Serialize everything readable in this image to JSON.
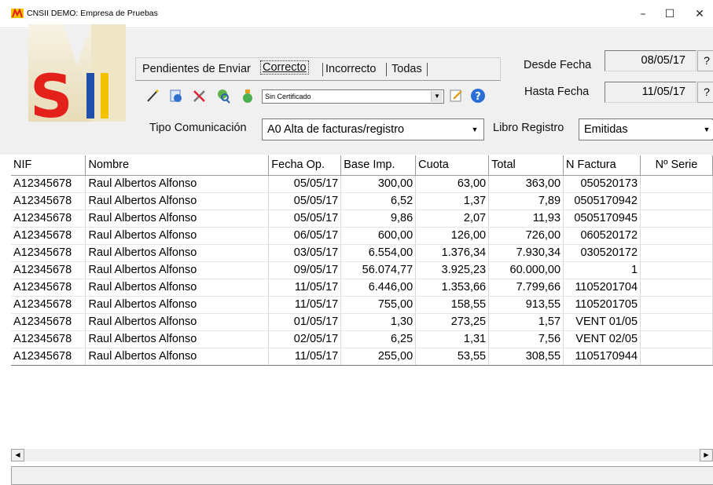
{
  "window": {
    "title": "CNSII DEMO: Empresa de Pruebas",
    "minimize": "–",
    "maximize": "☐",
    "close": "✕"
  },
  "header": {
    "logo_text": "SII",
    "tabs": [
      {
        "label": "Pendientes de Enviar",
        "active": false
      },
      {
        "label": "Correcto",
        "active": true
      },
      {
        "label": "Incorrecto",
        "active": false
      },
      {
        "label": "Todas",
        "active": false
      }
    ],
    "toolbar_icons": [
      "magic-wand-icon",
      "document-icon",
      "tools-icon",
      "search-globe-icon",
      "certificate-bag-icon"
    ],
    "certificate_select": "Sin Certificado",
    "after_select_icons": [
      "edit-icon",
      "help-icon"
    ],
    "desde_label": "Desde Fecha",
    "desde_value": "08/05/17",
    "hasta_label": "Hasta Fecha",
    "hasta_value": "11/05/17",
    "question": "?",
    "tipo_label": "Tipo Comunicación",
    "tipo_value": "A0 Alta de facturas/registro",
    "libro_label": "Libro Registro",
    "libro_value": "Emitidas"
  },
  "grid": {
    "columns": [
      "NIF",
      "Nombre",
      "Fecha Op.",
      "Base Imp.",
      "Cuota",
      "Total",
      "N Factura",
      "Nº Serie"
    ],
    "rows": [
      [
        "A12345678",
        "Raul Albertos Alfonso",
        "05/05/17",
        "300,00",
        "63,00",
        "363,00",
        "050520173",
        ""
      ],
      [
        "A12345678",
        "Raul Albertos Alfonso",
        "05/05/17",
        "6,52",
        "1,37",
        "7,89",
        "0505170942",
        ""
      ],
      [
        "A12345678",
        "Raul Albertos Alfonso",
        "05/05/17",
        "9,86",
        "2,07",
        "11,93",
        "0505170945",
        ""
      ],
      [
        "A12345678",
        "Raul Albertos Alfonso",
        "06/05/17",
        "600,00",
        "126,00",
        "726,00",
        "060520172",
        ""
      ],
      [
        "A12345678",
        "Raul Albertos Alfonso",
        "03/05/17",
        "6.554,00",
        "1.376,34",
        "7.930,34",
        "030520172",
        ""
      ],
      [
        "A12345678",
        "Raul Albertos Alfonso",
        "09/05/17",
        "56.074,77",
        "3.925,23",
        "60.000,00",
        "1",
        ""
      ],
      [
        "A12345678",
        "Raul Albertos Alfonso",
        "11/05/17",
        "6.446,00",
        "1.353,66",
        "7.799,66",
        "1105201704",
        ""
      ],
      [
        "A12345678",
        "Raul Albertos Alfonso",
        "11/05/17",
        "755,00",
        "158,55",
        "913,55",
        "1105201705",
        ""
      ],
      [
        "A12345678",
        "Raul Albertos Alfonso",
        "01/05/17",
        "1,30",
        "273,25",
        "1,57",
        "VENT 01/05",
        ""
      ],
      [
        "A12345678",
        "Raul Albertos Alfonso",
        "02/05/17",
        "6,25",
        "1,31",
        "7,56",
        "VENT 02/05",
        ""
      ],
      [
        "A12345678",
        "Raul Albertos Alfonso",
        "11/05/17",
        "255,00",
        "53,55",
        "308,55",
        "1105170944",
        ""
      ]
    ]
  },
  "scroll": {
    "left": "◀",
    "right": "▶"
  },
  "colors": {
    "logo_red": "#e32019",
    "logo_yellow": "#f3c300",
    "logo_blue": "#1f4fa8",
    "header_bg": "#f0f0f0"
  }
}
